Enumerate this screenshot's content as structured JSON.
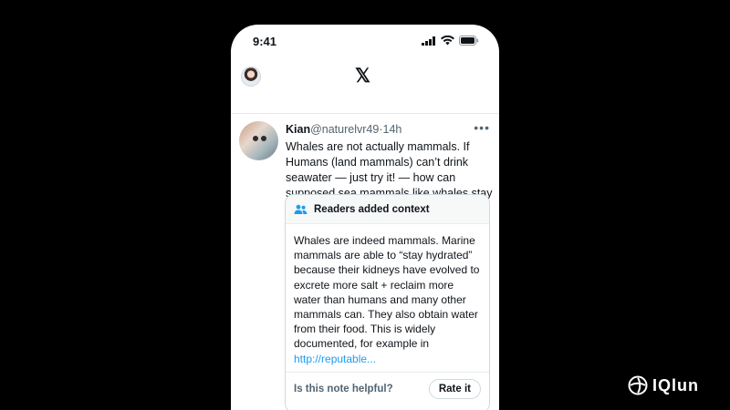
{
  "status_bar": {
    "time": "9:41"
  },
  "nav": {
    "logo": "𝕏"
  },
  "tweet": {
    "author_name": "Kian",
    "handle": "@naturelvr49",
    "separator": "·",
    "time": "14h",
    "more": "•••",
    "text": "Whales are not actually mammals. If Humans (land mammals) can’t drink seawater — just try it! — how can supposed sea mammals like whales stay hydrated?"
  },
  "context": {
    "title": "Readers added context",
    "body": "Whales are indeed mammals. Marine mammals are able to “stay hydrated” because their kidneys have evolved to excrete more salt + reclaim more water than humans and many other mammals can. They also obtain water from their food. This is widely documented, for example in ",
    "link": "http://reputable...",
    "helpful_question": "Is this note helpful?",
    "rate_button": "Rate it"
  },
  "watermark": {
    "text": "IQlun"
  },
  "colors": {
    "accent": "#1d9bf0",
    "background": "#000000",
    "text": "#0f1419",
    "muted": "#536471"
  }
}
